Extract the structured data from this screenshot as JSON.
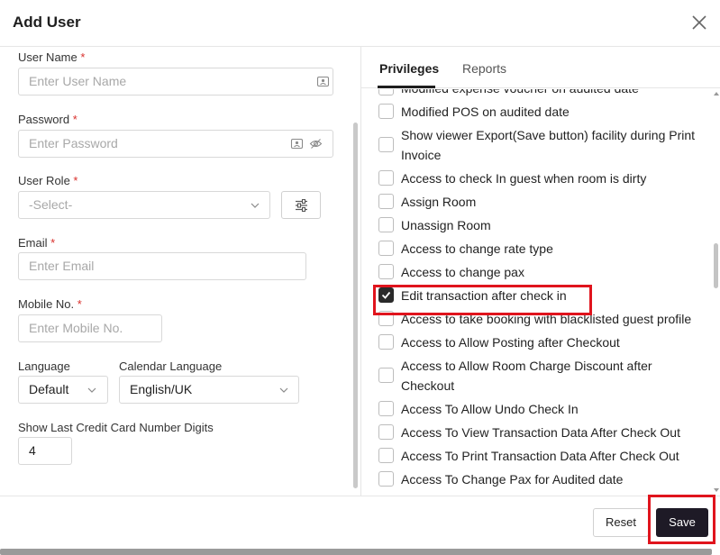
{
  "dialog": {
    "title": "Add User",
    "close_icon": "close-icon"
  },
  "form": {
    "username": {
      "label": "User Name",
      "required": "*",
      "placeholder": "Enter User Name"
    },
    "password": {
      "label": "Password",
      "required": "*",
      "placeholder": "Enter Password"
    },
    "user_role": {
      "label": "User Role",
      "required": "*",
      "placeholder": "-Select-"
    },
    "email": {
      "label": "Email",
      "required": "*",
      "placeholder": "Enter Email"
    },
    "mobile": {
      "label": "Mobile No.",
      "required": "*",
      "placeholder": "Enter Mobile No."
    },
    "language": {
      "label": "Language",
      "value": "Default"
    },
    "calendar_language": {
      "label": "Calendar Language",
      "value": "English/UK"
    },
    "credit_card_digits": {
      "label": "Show Last Credit Card Number Digits",
      "value": "4"
    }
  },
  "tabs": [
    {
      "label": "Privileges",
      "active": true
    },
    {
      "label": "Reports",
      "active": false
    }
  ],
  "privileges": [
    {
      "label": "Modified expense voucher on audited date",
      "checked": false
    },
    {
      "label": "Modified POS on audited date",
      "checked": false
    },
    {
      "label": "Show viewer Export(Save button) facility during Print Invoice",
      "checked": false
    },
    {
      "label": "Access to check In guest when room is dirty",
      "checked": false
    },
    {
      "label": "Assign Room",
      "checked": false
    },
    {
      "label": "Unassign Room",
      "checked": false
    },
    {
      "label": "Access to change rate type",
      "checked": false
    },
    {
      "label": "Access to change pax",
      "checked": false
    },
    {
      "label": "Edit transaction after check in",
      "checked": true
    },
    {
      "label": "Access to take booking with blacklisted guest profile",
      "checked": false
    },
    {
      "label": "Access to Allow Posting after Checkout",
      "checked": false
    },
    {
      "label": "Access to Allow Room Charge Discount after Checkout",
      "checked": false
    },
    {
      "label": "Access To Allow Undo Check In",
      "checked": false
    },
    {
      "label": "Access To View Transaction Data After Check Out",
      "checked": false
    },
    {
      "label": "Access To Print Transaction Data After Check Out",
      "checked": false
    },
    {
      "label": "Access To Change Pax for Audited date",
      "checked": false
    }
  ],
  "footer": {
    "reset_label": "Reset",
    "save_label": "Save"
  },
  "colors": {
    "highlight": "#e0141d",
    "save_button": "#1e1a26",
    "required": "#d9302c"
  }
}
